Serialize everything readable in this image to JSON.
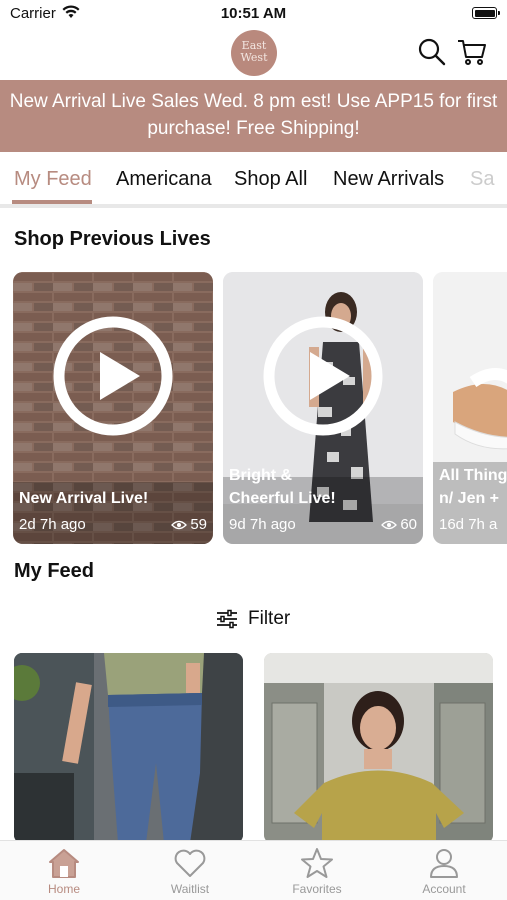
{
  "status_bar": {
    "carrier": "Carrier",
    "time": "10:51 AM"
  },
  "header": {
    "logo_line1": "East",
    "logo_line2": "West"
  },
  "banner": {
    "line1": "New Arrival Live Sales Wed. 8 pm est! Use APP15 for first",
    "line2": "purchase! Free Shipping!"
  },
  "tabs": [
    {
      "label": "My Feed",
      "active": true
    },
    {
      "label": "Americana"
    },
    {
      "label": "Shop All"
    },
    {
      "label": "New Arrivals"
    },
    {
      "label": "Sa"
    }
  ],
  "sections": {
    "previous_lives": "Shop Previous Lives",
    "my_feed": "My Feed"
  },
  "lives": [
    {
      "title_line1": "New Arrival Live!",
      "time": "2d 7h ago",
      "views": "59"
    },
    {
      "title_line1": "Bright &",
      "title_line2": "Cheerful Live!",
      "time": "9d 7h ago",
      "views": "60"
    },
    {
      "title_line1": "All Thing",
      "title_line2": "n/ Jen +",
      "time": "16d 7h a"
    }
  ],
  "filter": {
    "label": "Filter"
  },
  "bottom_nav": [
    {
      "label": "Home",
      "icon": "home-icon",
      "active": true
    },
    {
      "label": "Waitlist",
      "icon": "heart-icon"
    },
    {
      "label": "Favorites",
      "icon": "star-icon"
    },
    {
      "label": "Account",
      "icon": "person-icon"
    }
  ],
  "colors": {
    "accent": "#b78b80",
    "banner": "#b78b80",
    "inactive": "#999999"
  }
}
